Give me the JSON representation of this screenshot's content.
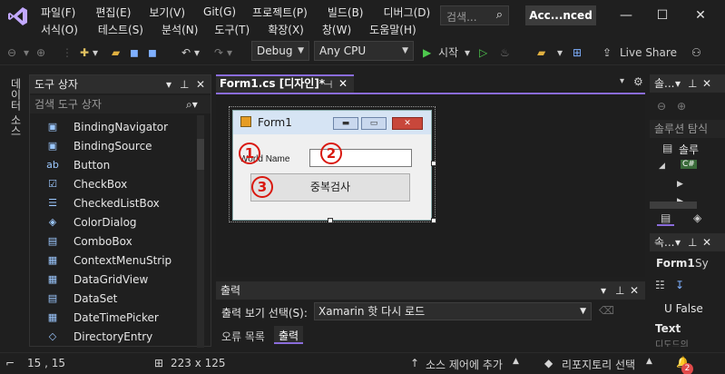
{
  "menu": {
    "row1": [
      "파일(F)",
      "편집(E)",
      "보기(V)",
      "Git(G)",
      "프로젝트(P)",
      "빌드(B)",
      "디버그(D)"
    ],
    "row2": [
      "서식(O)",
      "테스트(S)",
      "분석(N)",
      "도구(T)",
      "확장(X)",
      "창(W)",
      "도움말(H)"
    ],
    "search_placeholder": "검색...",
    "title": "Acc...nced"
  },
  "toolbar": {
    "config": "Debug",
    "platform": "Any CPU",
    "start_label": "시작",
    "live_share": "Live Share"
  },
  "left_vertical_tab": "데이터 소스",
  "toolbox": {
    "title": "도구 상자",
    "search_placeholder": "검색 도구 상자",
    "items": [
      {
        "label": "BindingNavigator",
        "icon": "binding-navigator-icon"
      },
      {
        "label": "BindingSource",
        "icon": "binding-source-icon"
      },
      {
        "label": "Button",
        "icon": "button-icon"
      },
      {
        "label": "CheckBox",
        "icon": "checkbox-icon"
      },
      {
        "label": "CheckedListBox",
        "icon": "checked-listbox-icon"
      },
      {
        "label": "ColorDialog",
        "icon": "color-dialog-icon"
      },
      {
        "label": "ComboBox",
        "icon": "combobox-icon"
      },
      {
        "label": "ContextMenuStrip",
        "icon": "context-menu-icon"
      },
      {
        "label": "DataGridView",
        "icon": "datagrid-icon"
      },
      {
        "label": "DataSet",
        "icon": "dataset-icon"
      },
      {
        "label": "DateTimePicker",
        "icon": "datetime-icon"
      },
      {
        "label": "DirectoryEntry",
        "icon": "directory-icon"
      }
    ]
  },
  "document": {
    "tab_label": "Form1.cs [디자인]*",
    "form_title": "Form1",
    "label_text": "World Name",
    "button_text": "중복검사",
    "annotations": [
      "1",
      "2",
      "3"
    ]
  },
  "output": {
    "title": "출력",
    "source_label": "출력 보기 선택(S):",
    "source_value": "Xamarin 핫 다시 로드",
    "tabs": [
      "오류 목록",
      "출력"
    ]
  },
  "solution": {
    "title": "솔...",
    "search": "솔루션 탐식",
    "tree": [
      "솔루",
      "C#"
    ]
  },
  "properties": {
    "title": "속...",
    "name": "Form1",
    "type": "Sy",
    "row_value": "U  False",
    "row_label": "Text",
    "row_sub": "디도드의"
  },
  "status": {
    "cursor": "15 , 15",
    "size": "223 x 125",
    "source_control": "소스 제어에 추가",
    "repo": "리포지토리 선택",
    "notifications": "2"
  }
}
